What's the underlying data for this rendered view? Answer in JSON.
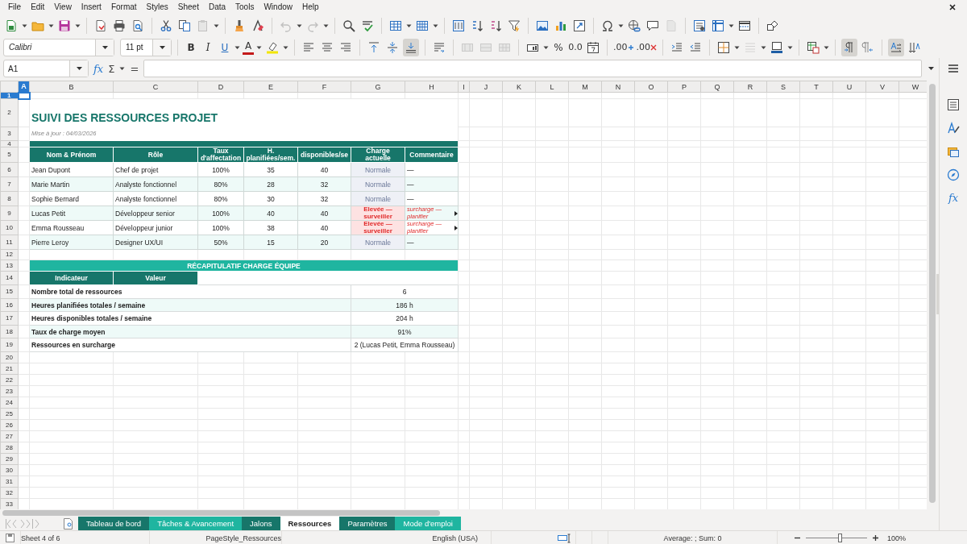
{
  "menu": [
    "File",
    "Edit",
    "View",
    "Insert",
    "Format",
    "Styles",
    "Sheet",
    "Data",
    "Tools",
    "Window",
    "Help"
  ],
  "format_toolbar": {
    "font_name": "Calibri",
    "font_size": "11 pt",
    "bold": "B",
    "italic": "I",
    "underline": "U",
    "font_color": "A",
    "percent": "%",
    "number": "0.0",
    "add_decimal": ".00",
    "delete_decimal": ".00"
  },
  "toolbar_states": {
    "paste": {
      "disabled": true
    },
    "undo": {
      "disabled": true
    },
    "redo": {
      "disabled": true
    },
    "header": {
      "disabled": true
    },
    "merge": {
      "disabled": true
    },
    "merge_center": {
      "disabled": true
    },
    "unmerge": {
      "disabled": true
    },
    "border_style": {
      "disabled": true
    },
    "align_bottom": {
      "pressed": true
    },
    "ltr": {
      "pressed": true
    },
    "vertical_text": {
      "pressed": true
    }
  },
  "formula_bar": {
    "name_box": "A1",
    "function_wizard": "fx",
    "sum": "Σ",
    "equals": "="
  },
  "column_headers": [
    {
      "label": "A",
      "selected": true
    },
    {
      "label": "B",
      "selected": false
    },
    {
      "label": "C",
      "selected": false
    },
    {
      "label": "D",
      "selected": false
    },
    {
      "label": "E",
      "selected": false
    },
    {
      "label": "F",
      "selected": false
    },
    {
      "label": "G",
      "selected": false
    },
    {
      "label": "H",
      "selected": false
    },
    {
      "label": "I",
      "selected": false
    },
    {
      "label": "J",
      "selected": false
    },
    {
      "label": "K",
      "selected": false
    },
    {
      "label": "L",
      "selected": false
    },
    {
      "label": "M",
      "selected": false
    },
    {
      "label": "N",
      "selected": false
    },
    {
      "label": "O",
      "selected": false
    },
    {
      "label": "P",
      "selected": false
    },
    {
      "label": "Q",
      "selected": false
    },
    {
      "label": "R",
      "selected": false
    },
    {
      "label": "S",
      "selected": false
    },
    {
      "label": "T",
      "selected": false
    },
    {
      "label": "U",
      "selected": false
    },
    {
      "label": "V",
      "selected": false
    },
    {
      "label": "W",
      "selected": false
    }
  ],
  "row_headers": [
    {
      "label": "1",
      "selected": true
    },
    {
      "label": "2",
      "selected": false
    },
    {
      "label": "3",
      "selected": false
    },
    {
      "label": "4",
      "selected": false
    },
    {
      "label": "5",
      "selected": false
    },
    {
      "label": "6",
      "selected": false
    },
    {
      "label": "7",
      "selected": false
    },
    {
      "label": "8",
      "selected": false
    },
    {
      "label": "9",
      "selected": false
    },
    {
      "label": "10",
      "selected": false
    },
    {
      "label": "11",
      "selected": false
    },
    {
      "label": "12",
      "selected": false
    },
    {
      "label": "13",
      "selected": false
    },
    {
      "label": "14",
      "selected": false
    },
    {
      "label": "15",
      "selected": false
    },
    {
      "label": "16",
      "selected": false
    },
    {
      "label": "17",
      "selected": false
    },
    {
      "label": "18",
      "selected": false
    },
    {
      "label": "19",
      "selected": false
    },
    {
      "label": "20",
      "selected": false
    },
    {
      "label": "21",
      "selected": false
    },
    {
      "label": "22",
      "selected": false
    },
    {
      "label": "23",
      "selected": false
    },
    {
      "label": "24",
      "selected": false
    },
    {
      "label": "25",
      "selected": false
    },
    {
      "label": "26",
      "selected": false
    },
    {
      "label": "27",
      "selected": false
    },
    {
      "label": "28",
      "selected": false
    },
    {
      "label": "29",
      "selected": false
    },
    {
      "label": "30",
      "selected": false
    },
    {
      "label": "31",
      "selected": false
    },
    {
      "label": "32",
      "selected": false
    },
    {
      "label": "33",
      "selected": false
    }
  ],
  "sheet": {
    "title": "SUIVI DES RESSOURCES PROJET",
    "updated": "Mise à jour : 04/03/2026",
    "table": {
      "columns": [
        "Nom & Prénom",
        "Rôle",
        "Taux d'affectation",
        "H. planifiées/sem.",
        "disponibles/se",
        "Charge actuelle",
        "Commentaire"
      ],
      "rows": [
        {
          "name": "Jean Dupont",
          "role": "Chef de projet",
          "rate": "100%",
          "planned": "35",
          "available": "40",
          "load": "Normale",
          "comment": "—",
          "alert": false
        },
        {
          "name": "Marie Martin",
          "role": "Analyste fonctionnel",
          "rate": "80%",
          "planned": "28",
          "available": "32",
          "load": "Normale",
          "comment": "—",
          "alert": false
        },
        {
          "name": "Sophie Bernard",
          "role": "Analyste fonctionnel",
          "rate": "80%",
          "planned": "30",
          "available": "32",
          "load": "Normale",
          "comment": "—",
          "alert": false
        },
        {
          "name": "Lucas Petit",
          "role": "Développeur senior",
          "rate": "100%",
          "planned": "40",
          "available": "40",
          "load": "Elevée — surveiller",
          "comment": "surcharge — planifier",
          "alert": true
        },
        {
          "name": "Emma Rousseau",
          "role": "Développeur junior",
          "rate": "100%",
          "planned": "38",
          "available": "40",
          "load": "Elevée — surveiller",
          "comment": "surcharge — planifier",
          "alert": true
        },
        {
          "name": "Pierre Leroy",
          "role": "Designer UX/UI",
          "rate": "50%",
          "planned": "15",
          "available": "20",
          "load": "Normale",
          "comment": "—",
          "alert": false
        }
      ]
    },
    "summary": {
      "title": "RÉCAPITULATIF CHARGE ÉQUIPE",
      "columns": [
        "Indicateur",
        "Valeur"
      ],
      "rows": [
        {
          "label": "Nombre total de ressources",
          "value": "6"
        },
        {
          "label": "Heures planifiées totales / semaine",
          "value": "186 h"
        },
        {
          "label": "Heures disponibles totales / semaine",
          "value": "204 h"
        },
        {
          "label": "Taux de charge moyen",
          "value": "91%"
        },
        {
          "label": "Ressources en surcharge",
          "value": "2 (Lucas Petit, Emma Rousseau)"
        }
      ]
    }
  },
  "sheet_tabs": [
    {
      "label": "Tableau de bord",
      "selected": false,
      "color": "#17766a"
    },
    {
      "label": "Tâches & Avancement",
      "selected": false,
      "color": "#1fb5a0"
    },
    {
      "label": "Jalons",
      "selected": false,
      "color": "#17766a"
    },
    {
      "label": "Ressources",
      "selected": true
    },
    {
      "label": "Paramètres",
      "selected": false,
      "color": "#17766a"
    },
    {
      "label": "Mode d'emploi",
      "selected": false,
      "color": "#1fb5a0"
    }
  ],
  "sidebar": {
    "functions": "fx"
  },
  "status_bar": {
    "sheet": "Sheet 4 of 6",
    "page_style": "PageStyle_Ressources",
    "language": "English (USA)",
    "selection_summary": "Average: ; Sum: 0",
    "zoom": "100%",
    "zoom_slider": {
      "level": 0.55
    }
  }
}
